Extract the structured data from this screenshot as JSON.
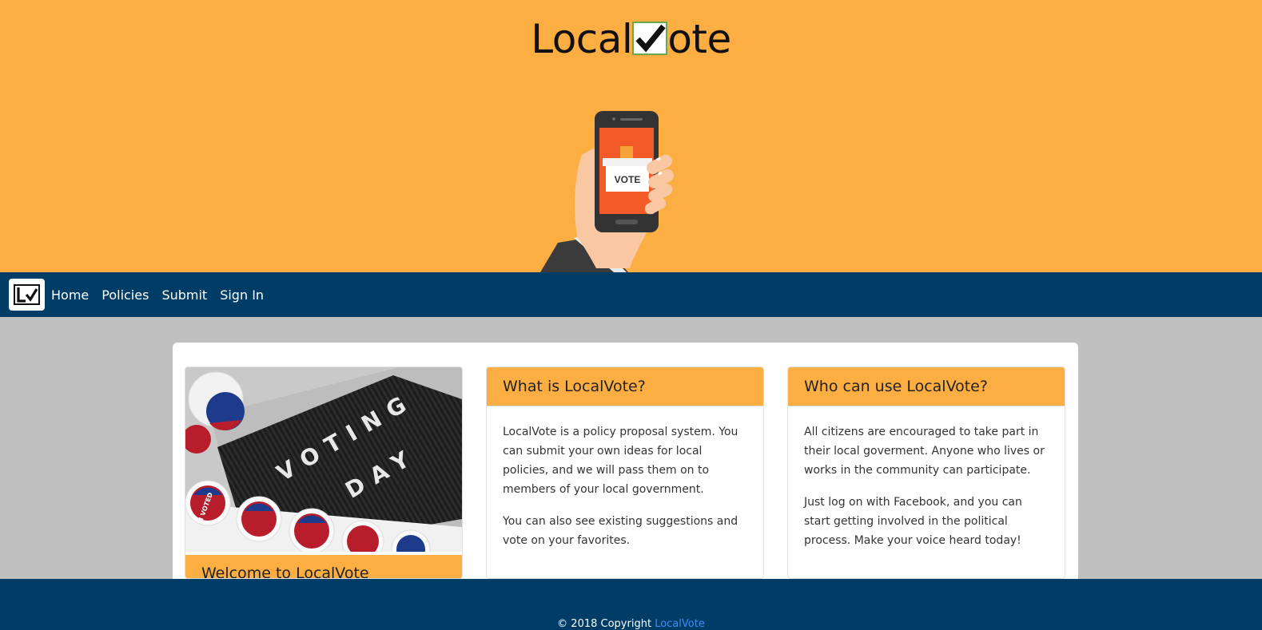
{
  "brand": {
    "name_before": "Local",
    "name_after": "ote",
    "check_icon": "checkmark-icon"
  },
  "hero": {
    "illustration_text": "VOTE"
  },
  "nav": {
    "logo_icon": "localvote-logo-icon",
    "items": [
      {
        "label": "Home"
      },
      {
        "label": "Policies"
      },
      {
        "label": "Submit"
      },
      {
        "label": "Sign In"
      }
    ]
  },
  "cards": [
    {
      "type": "image",
      "image_text_1": "VOTING",
      "image_text_2": "DAY",
      "sticker_text": "I VOTED",
      "title": "Welcome to LocalVote"
    },
    {
      "title": "What is LocalVote?",
      "paragraphs": [
        "LocalVote is a policy proposal system. You can submit your own ideas for local policies, and we will pass them on to members of your local government.",
        "You can also see existing suggestions and vote on your favorites."
      ]
    },
    {
      "title": "Who can use LocalVote?",
      "paragraphs": [
        "All citizens are encouraged to take part in their local goverment. Anyone who lives or works in the community can participate.",
        "Just log on with Facebook, and you can start getting involved in the political process. Make your voice heard today!"
      ]
    }
  ],
  "footer": {
    "copyright": "© 2018 Copyright",
    "link_label": "LocalVote"
  },
  "colors": {
    "hero_bg": "#fdae42",
    "nav_bg": "#003d66",
    "page_bg": "#c0c0c0",
    "footer_link": "#3b8df7"
  }
}
